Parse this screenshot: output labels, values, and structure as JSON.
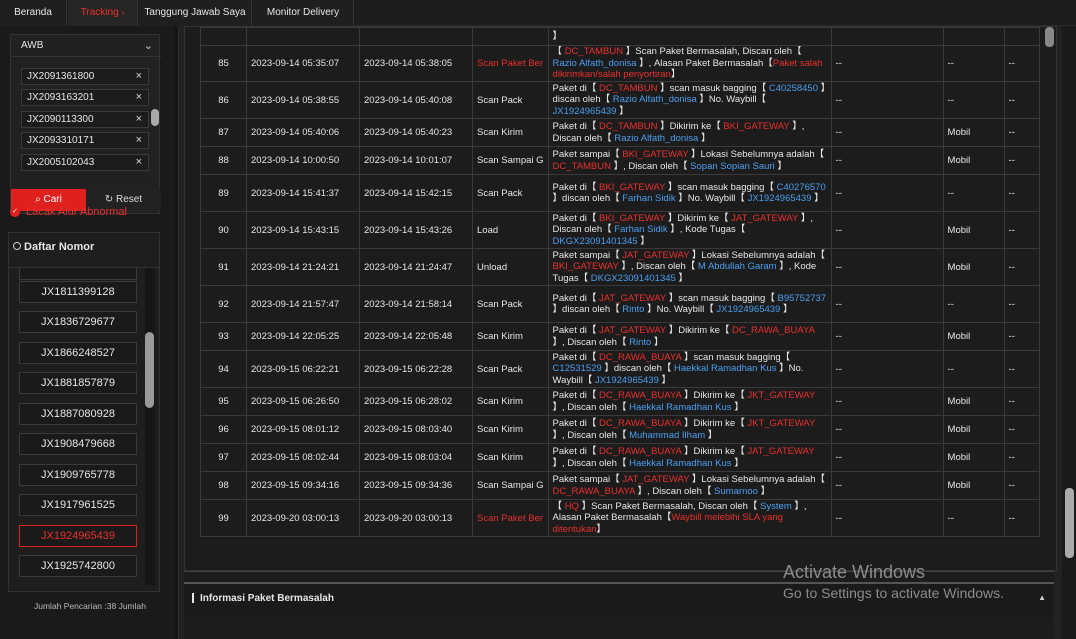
{
  "tabs": [
    {
      "label": "Beranda",
      "active": false
    },
    {
      "label": "Tracking",
      "active": true
    },
    {
      "label": "Tanggung Jawab Saya",
      "active": false
    },
    {
      "label": "Monitor Delivery",
      "active": false
    }
  ],
  "filter": {
    "select_value": "AWB",
    "awb_chips": [
      "JX2091361800",
      "JX2093163201",
      "JX2090113300",
      "JX2093310171",
      "JX2005102043"
    ],
    "search_label": "Cari",
    "reset_label": "Reset",
    "abnormal_label": "Lacak Alur Abnormal"
  },
  "daftar": {
    "title": "Daftar Nomor",
    "numbers": [
      "",
      "JX1811399128",
      "JX1836729677",
      "JX1866248527",
      "JX1881857879",
      "JX1887080928",
      "JX1908479668",
      "JX1909765778",
      "JX1917961525",
      "JX1924965439",
      "JX1925742800"
    ],
    "selected": "JX1924965439",
    "footer": "Jumlah Pencarian :38  Jumlah"
  },
  "table": {
    "rows": [
      {
        "no": "85",
        "t1": "2023-09-14 05:35:07",
        "t2": "2023-09-14 05:38:05",
        "status": "Scan Paket Ber",
        "status_color": "red",
        "ket": [
          [
            "】",
            ""
          ],
          [
            "【 ",
            ""
          ],
          [
            "DC_TAMBUN",
            "red"
          ],
          [
            " 】Scan Paket Bermasalah, Discan oleh【 ",
            ""
          ],
          [
            "Razio Alfath_donisa",
            "blue"
          ],
          [
            " 】, Alasan Paket Bermasalah【",
            ""
          ],
          [
            "Paket salah dikirimkan/salah penyortiran",
            "red"
          ],
          [
            "】",
            ""
          ]
        ],
        "e1": "--",
        "e2": "--",
        "e3": "--"
      },
      {
        "no": "86",
        "t1": "2023-09-14 05:38:55",
        "t2": "2023-09-14 05:40:08",
        "status": "Scan Pack",
        "status_color": "",
        "ket": [
          [
            "Paket di【 ",
            ""
          ],
          [
            "DC_TAMBUN",
            "red"
          ],
          [
            " 】scan masuk bagging【 ",
            ""
          ],
          [
            "C40258450",
            "blue"
          ],
          [
            " 】discan oleh【 ",
            ""
          ],
          [
            "Razio Alfath_donisa",
            "blue"
          ],
          [
            " 】No. Waybill【 ",
            ""
          ],
          [
            "JX1924965439",
            "blue"
          ],
          [
            " 】",
            ""
          ]
        ],
        "e1": "--",
        "e2": "--",
        "e3": "--"
      },
      {
        "no": "87",
        "t1": "2023-09-14 05:40:06",
        "t2": "2023-09-14 05:40:23",
        "status": "Scan Kirim",
        "status_color": "",
        "ket": [
          [
            "Paket di【 ",
            ""
          ],
          [
            "DC_TAMBUN",
            "red"
          ],
          [
            " 】Dikirim ke【 ",
            ""
          ],
          [
            "BKI_GATEWAY",
            "red"
          ],
          [
            " 】, Discan oleh【 ",
            ""
          ],
          [
            "Razio Alfath_donisa",
            "blue"
          ],
          [
            " 】",
            ""
          ]
        ],
        "e1": "--",
        "e2": "Mobil",
        "e3": "--"
      },
      {
        "no": "88",
        "t1": "2023-09-14 10:00:50",
        "t2": "2023-09-14 10:01:07",
        "status": "Scan Sampai G",
        "status_color": "",
        "ket": [
          [
            "Paket sampai【 ",
            ""
          ],
          [
            "BKI_GATEWAY",
            "red"
          ],
          [
            " 】Lokasi Sebelumnya adalah【 ",
            ""
          ],
          [
            "DC_TAMBUN",
            "red"
          ],
          [
            " 】, Discan oleh【 ",
            ""
          ],
          [
            "Sopan Sopian Sauri",
            "blue"
          ],
          [
            " 】",
            ""
          ]
        ],
        "e1": "--",
        "e2": "Mobil",
        "e3": "--"
      },
      {
        "no": "89",
        "t1": "2023-09-14 15:41:37",
        "t2": "2023-09-14 15:42:15",
        "status": "Scan Pack",
        "status_color": "",
        "ket": [
          [
            "Paket di【 ",
            ""
          ],
          [
            "BKI_GATEWAY",
            "red"
          ],
          [
            " 】scan masuk bagging【 ",
            ""
          ],
          [
            "C40276570",
            "blue"
          ],
          [
            " 】discan oleh【 ",
            ""
          ],
          [
            "Farhan Sidik",
            "blue"
          ],
          [
            " 】No. Waybill【 ",
            ""
          ],
          [
            "JX1924965439",
            "blue"
          ],
          [
            " 】",
            ""
          ]
        ],
        "e1": "--",
        "e2": "--",
        "e3": "--"
      },
      {
        "no": "90",
        "t1": "2023-09-14 15:43:15",
        "t2": "2023-09-14 15:43:26",
        "status": "Load",
        "status_color": "",
        "ket": [
          [
            "Paket di【 ",
            ""
          ],
          [
            "BKI_GATEWAY",
            "red"
          ],
          [
            " 】Dikirim ke【 ",
            ""
          ],
          [
            "JAT_GATEWAY",
            "red"
          ],
          [
            " 】, Discan oleh【 ",
            ""
          ],
          [
            "Farhan Sidik",
            "blue"
          ],
          [
            " 】, Kode Tugas【 ",
            ""
          ],
          [
            "DKGX23091401345",
            "blue"
          ],
          [
            " 】",
            ""
          ]
        ],
        "e1": "--",
        "e2": "Mobil",
        "e3": "--"
      },
      {
        "no": "91",
        "t1": "2023-09-14 21:24:21",
        "t2": "2023-09-14 21:24:47",
        "status": "Unload",
        "status_color": "",
        "ket": [
          [
            "Paket sampai【 ",
            ""
          ],
          [
            "JAT_GATEWAY",
            "red"
          ],
          [
            " 】Lokasi Sebelumnya adalah【 ",
            ""
          ],
          [
            "BKI_GATEWAY",
            "red"
          ],
          [
            " 】, Discan oleh【 ",
            ""
          ],
          [
            "M Abdullah Garam",
            "blue"
          ],
          [
            " 】, Kode Tugas【 ",
            ""
          ],
          [
            "DKGX23091401345",
            "blue"
          ],
          [
            " 】",
            ""
          ]
        ],
        "e1": "--",
        "e2": "Mobil",
        "e3": "--"
      },
      {
        "no": "92",
        "t1": "2023-09-14 21:57:47",
        "t2": "2023-09-14 21:58:14",
        "status": "Scan Pack",
        "status_color": "",
        "ket": [
          [
            "Paket di【 ",
            ""
          ],
          [
            "JAT_GATEWAY",
            "red"
          ],
          [
            " 】scan masuk bagging【 ",
            ""
          ],
          [
            "B95752737",
            "blue"
          ],
          [
            " 】discan oleh【 ",
            ""
          ],
          [
            "Rinto",
            "blue"
          ],
          [
            " 】No. Waybill【 ",
            ""
          ],
          [
            "JX1924965439",
            "blue"
          ],
          [
            " 】",
            ""
          ]
        ],
        "e1": "--",
        "e2": "--",
        "e3": "--"
      },
      {
        "no": "93",
        "t1": "2023-09-14 22:05:25",
        "t2": "2023-09-14 22:05:48",
        "status": "Scan Kirim",
        "status_color": "",
        "ket": [
          [
            "Paket di【 ",
            ""
          ],
          [
            "JAT_GATEWAY",
            "red"
          ],
          [
            " 】Dikirim ke【 ",
            ""
          ],
          [
            "DC_RAWA_BUAYA",
            "red"
          ],
          [
            " 】, Discan oleh【 ",
            ""
          ],
          [
            "Rinto",
            "blue"
          ],
          [
            " 】",
            ""
          ]
        ],
        "e1": "--",
        "e2": "Mobil",
        "e3": "--"
      },
      {
        "no": "94",
        "t1": "2023-09-15 06:22:21",
        "t2": "2023-09-15 06:22:28",
        "status": "Scan Pack",
        "status_color": "",
        "ket": [
          [
            "Paket di【 ",
            ""
          ],
          [
            "DC_RAWA_BUAYA",
            "red"
          ],
          [
            " 】scan masuk bagging【 ",
            ""
          ],
          [
            "C12531529",
            "blue"
          ],
          [
            " 】discan oleh【 ",
            ""
          ],
          [
            "Haekkal Ramadhan Kus",
            "blue"
          ],
          [
            " 】No. Waybill【 ",
            ""
          ],
          [
            "JX1924965439",
            "blue"
          ],
          [
            " 】",
            ""
          ]
        ],
        "e1": "--",
        "e2": "--",
        "e3": "--"
      },
      {
        "no": "95",
        "t1": "2023-09-15 06:26:50",
        "t2": "2023-09-15 06:28:02",
        "status": "Scan Kirim",
        "status_color": "",
        "ket": [
          [
            "Paket di【 ",
            ""
          ],
          [
            "DC_RAWA_BUAYA",
            "red"
          ],
          [
            " 】Dikirim ke【 ",
            ""
          ],
          [
            "JKT_GATEWAY",
            "red"
          ],
          [
            " 】, Discan oleh【 ",
            ""
          ],
          [
            "Haekkal Ramadhan Kus",
            "blue"
          ],
          [
            " 】",
            ""
          ]
        ],
        "e1": "--",
        "e2": "Mobil",
        "e3": "--"
      },
      {
        "no": "96",
        "t1": "2023-09-15 08:01:12",
        "t2": "2023-09-15 08:03:40",
        "status": "Scan Kirim",
        "status_color": "",
        "ket": [
          [
            "Paket di【 ",
            ""
          ],
          [
            "DC_RAWA_BUAYA",
            "red"
          ],
          [
            " 】Dikirim ke【 ",
            ""
          ],
          [
            "JKT_GATEWAY",
            "red"
          ],
          [
            " 】, Discan oleh【 ",
            ""
          ],
          [
            "Muhammad Ilham",
            "blue"
          ],
          [
            " 】",
            ""
          ]
        ],
        "e1": "--",
        "e2": "Mobil",
        "e3": "--"
      },
      {
        "no": "97",
        "t1": "2023-09-15 08:02:44",
        "t2": "2023-09-15 08:03:04",
        "status": "Scan Kirim",
        "status_color": "",
        "ket": [
          [
            "Paket di【 ",
            ""
          ],
          [
            "DC_RAWA_BUAYA",
            "red"
          ],
          [
            " 】Dikirim ke【 ",
            ""
          ],
          [
            "JAT_GATEWAY",
            "red"
          ],
          [
            " 】, Discan oleh【 ",
            ""
          ],
          [
            "Haekkal Ramadhan Kus",
            "blue"
          ],
          [
            " 】",
            ""
          ]
        ],
        "e1": "--",
        "e2": "Mobil",
        "e3": "--"
      },
      {
        "no": "98",
        "t1": "2023-09-15 09:34:16",
        "t2": "2023-09-15 09:34:36",
        "status": "Scan Sampai G",
        "status_color": "",
        "ket": [
          [
            "Paket sampai【 ",
            ""
          ],
          [
            "JAT_GATEWAY",
            "red"
          ],
          [
            " 】Lokasi Sebelumnya adalah【 ",
            ""
          ],
          [
            "DC_RAWA_BUAYA",
            "red"
          ],
          [
            " 】, Discan oleh【 ",
            ""
          ],
          [
            "Sumarnoo",
            "blue"
          ],
          [
            " 】",
            ""
          ]
        ],
        "e1": "--",
        "e2": "Mobil",
        "e3": "--"
      },
      {
        "no": "99",
        "t1": "2023-09-20 03:00:13",
        "t2": "2023-09-20 03:00:13",
        "status": "Scan Paket Ber",
        "status_color": "red",
        "ket": [
          [
            "【 ",
            ""
          ],
          [
            "HQ",
            "red"
          ],
          [
            " 】Scan Paket Bermasalah, Discan oleh【 ",
            ""
          ],
          [
            "System",
            "blue"
          ],
          [
            " 】, Alasan Paket Bermasalah【",
            ""
          ],
          [
            "Waybill melebihi SLA yang ditentukan",
            "red"
          ],
          [
            "】",
            ""
          ]
        ],
        "e1": "--",
        "e2": "--",
        "e3": "--"
      }
    ]
  },
  "info_section": {
    "title": "Informasi Paket Bermasalah",
    "toggle": "▲"
  },
  "watermark": {
    "line1": "Activate Windows",
    "line2": "Go to Settings to activate Windows."
  },
  "colors": {
    "accent": "#e0201f",
    "link": "#4a9ff0",
    "bg": "#141414"
  }
}
